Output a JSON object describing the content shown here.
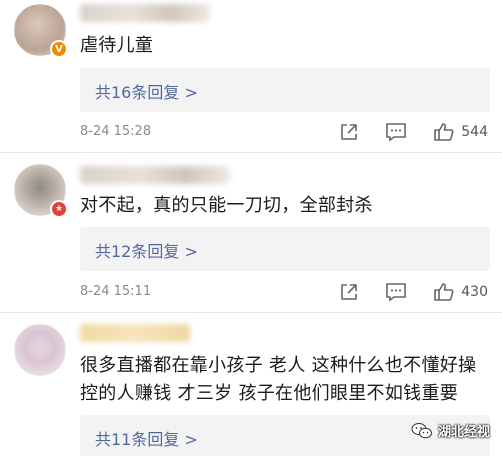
{
  "comments": [
    {
      "text": "虐待儿童",
      "replies_label": "共16条回复 >",
      "timestamp": "8-24 15:28",
      "likes": "544",
      "badge": "V"
    },
    {
      "text": "对不起，真的只能一刀切，全部封杀",
      "replies_label": "共12条回复 >",
      "timestamp": "8-24 15:11",
      "likes": "430",
      "badge": "★"
    },
    {
      "text_lines": [
        "很多直播都在靠小孩子 老人 这种什么也不懂好操",
        "控的人赚钱 才三岁 孩子在他们眼里不如钱重要"
      ],
      "replies_label": "共11条回复 >"
    }
  ],
  "icons": {
    "repost": "share-icon",
    "comment": "comment-icon",
    "like": "thumbs-up-icon",
    "watermark": "wechat-icon"
  },
  "colors": {
    "link": "#53699c",
    "reply_box": "#f3f3f3",
    "verified_orange": "#f08a00",
    "badge_red": "#e0403a"
  },
  "watermark": {
    "label": "湖北经视"
  }
}
